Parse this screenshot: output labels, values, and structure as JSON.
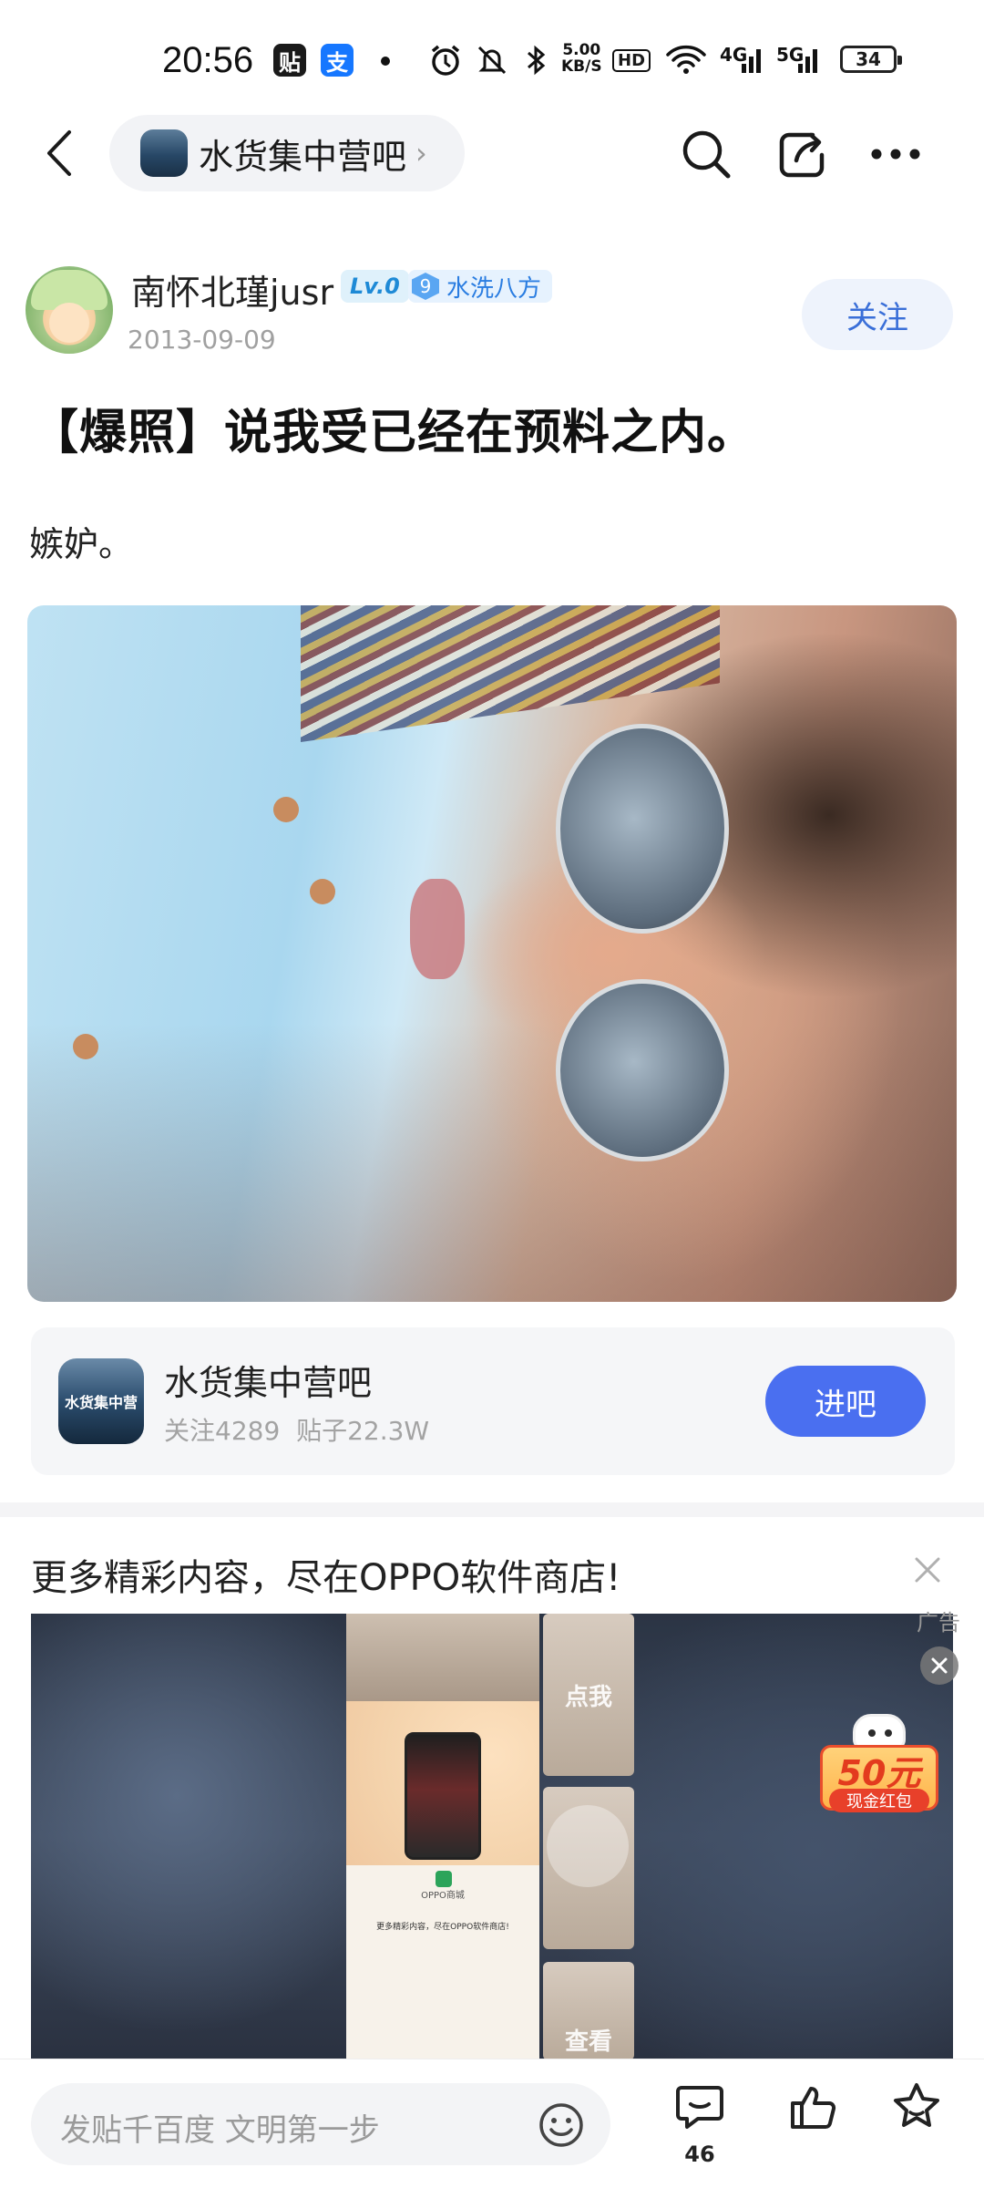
{
  "status_bar": {
    "time": "20:56",
    "app_icons": [
      "贴",
      "支"
    ],
    "net_speed_value": "5.00",
    "net_speed_unit": "KB/S",
    "hd_label": "HD",
    "signal_1": "4G",
    "signal_2": "5G",
    "battery": "34"
  },
  "header": {
    "forum_name": "水货集中营吧"
  },
  "author": {
    "name": "南怀北瑾jusr",
    "level": "Lv.0",
    "rank_number": "9",
    "rank_title": "水洗八方",
    "date": "2013-09-09",
    "follow_label": "关注"
  },
  "post": {
    "title": "【爆照】说我受已经在预料之内。",
    "body": "嫉妒。"
  },
  "forum_card": {
    "thumb_text": "水货集中营",
    "name": "水货集中营吧",
    "followers": "关注4289",
    "posts": "贴子22.3W",
    "join_label": "进吧"
  },
  "ad": {
    "title": "更多精彩内容，尽在OPPO软件商店!",
    "label": "广告",
    "tile_1": "点我",
    "tile_3": "查看",
    "store_name": "OPPO商城",
    "caption": "更多精彩内容，尽在OPPO软件商店!",
    "amount": "50元",
    "packet_text": "现金红包"
  },
  "bottom_bar": {
    "placeholder": "发贴千百度 文明第一步",
    "comment_count": "46"
  }
}
